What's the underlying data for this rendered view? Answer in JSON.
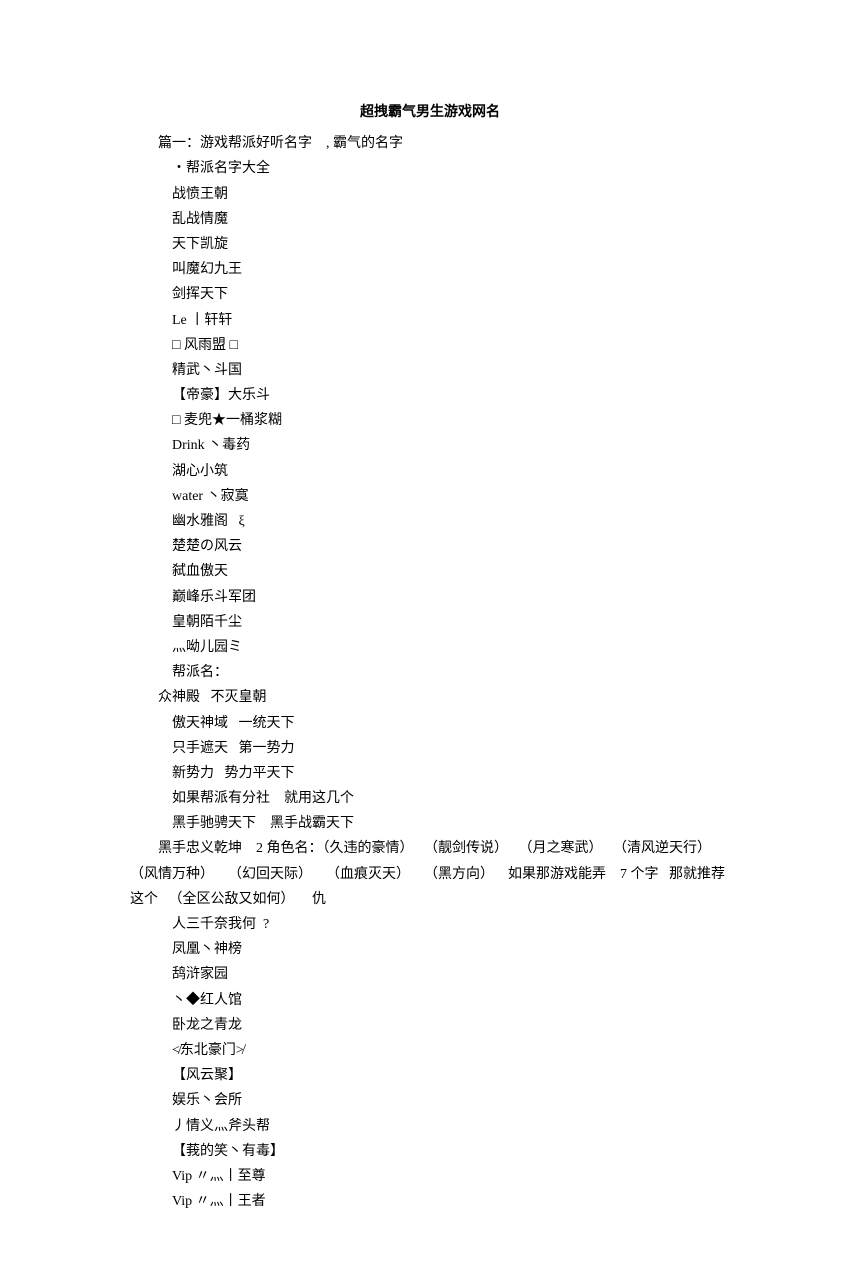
{
  "title": "超拽霸气男生游戏网名",
  "section1_header": "篇一：游戏帮派好听名字    , 霸气的名字",
  "subtitle1": "・帮派名字大全",
  "names1": [
    "战愤王朝",
    "乱战情魔",
    "天下凯旋",
    "叫魔幻九王",
    "剑挥天下",
    "Le 丨轩轩",
    "□ 风雨盟 □",
    "精武丶斗国",
    "【帝豪】大乐斗",
    "□ 麦兜★一桶浆糊",
    "Drink 丶毒药",
    "湖心小筑",
    "water 丶寂寞",
    "幽水雅阁   ξ",
    "楚楚の风云",
    "弑血傲天",
    "巅峰乐斗军团",
    "皇朝陌千尘",
    "灬呦儿园ミ",
    "帮派名："
  ],
  "line_indent2_1": "众神殿   不灭皇朝",
  "names2": [
    "傲天神域   一统天下",
    "只手遮天   第一势力",
    "新势力   势力平天下",
    "如果帮派有分社    就用这几个",
    "黑手驰骋天下    黑手战霸天下"
  ],
  "paragraph1_line1": "黑手忠义乾坤    2 角色名：（久违的豪情）   （靓剑传说）   （月之寒武）   （清风逆天行）",
  "paragraph1_line2": "（风情万种）    （幻回天际）    （血痕灭天）    （黑方向）    如果那游戏能弄    7 个字   那就推荐",
  "paragraph1_line3": "这个   （全区公敌又如何）     仇",
  "names3": [
    "人三千奈我何  ?",
    "凤凰丶神榜",
    "鸹浒家园",
    "丶◆红人馆",
    "卧龙之青龙",
    "≮东北豪门≯",
    "【风云聚】",
    "娱乐丶会所",
    "丿情义灬斧头帮",
    "【莪的笑丶有毒】",
    "Vip 〃灬丨至尊",
    "Vip 〃灬丨王者"
  ]
}
